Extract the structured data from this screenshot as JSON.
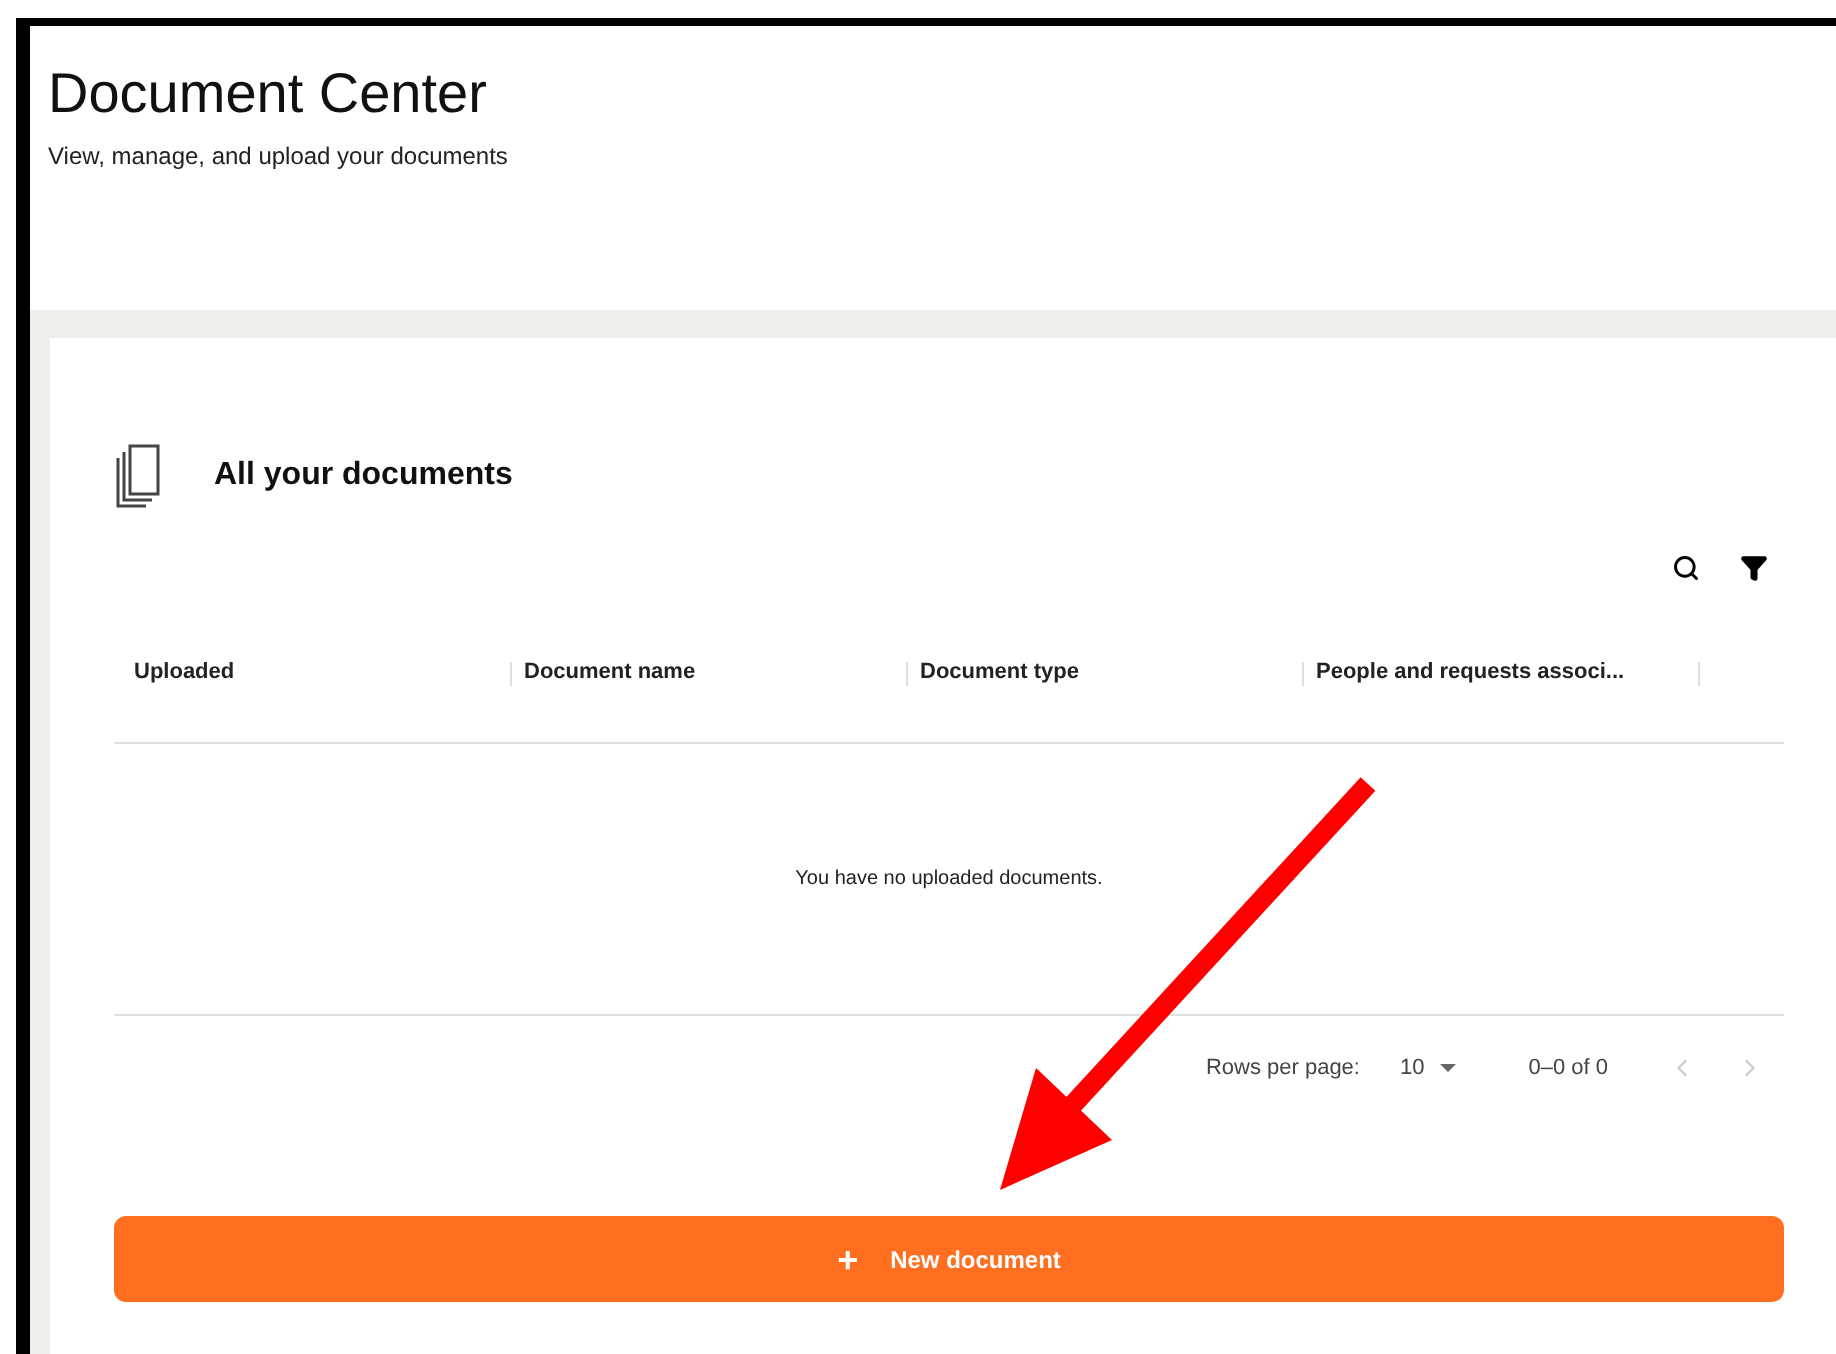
{
  "page": {
    "title": "Document Center",
    "subtitle": "View, manage, and upload your documents"
  },
  "card": {
    "title": "All your documents"
  },
  "table": {
    "columns": [
      "Uploaded",
      "Document name",
      "Document type",
      "People and requests associ..."
    ],
    "empty_message": "You have no uploaded documents."
  },
  "pagination": {
    "rows_label": "Rows per page:",
    "rows_value": "10",
    "range": "0–0 of 0",
    "prev_disabled": true,
    "next_disabled": true
  },
  "new_button": {
    "label": "New document",
    "icon": "+"
  }
}
